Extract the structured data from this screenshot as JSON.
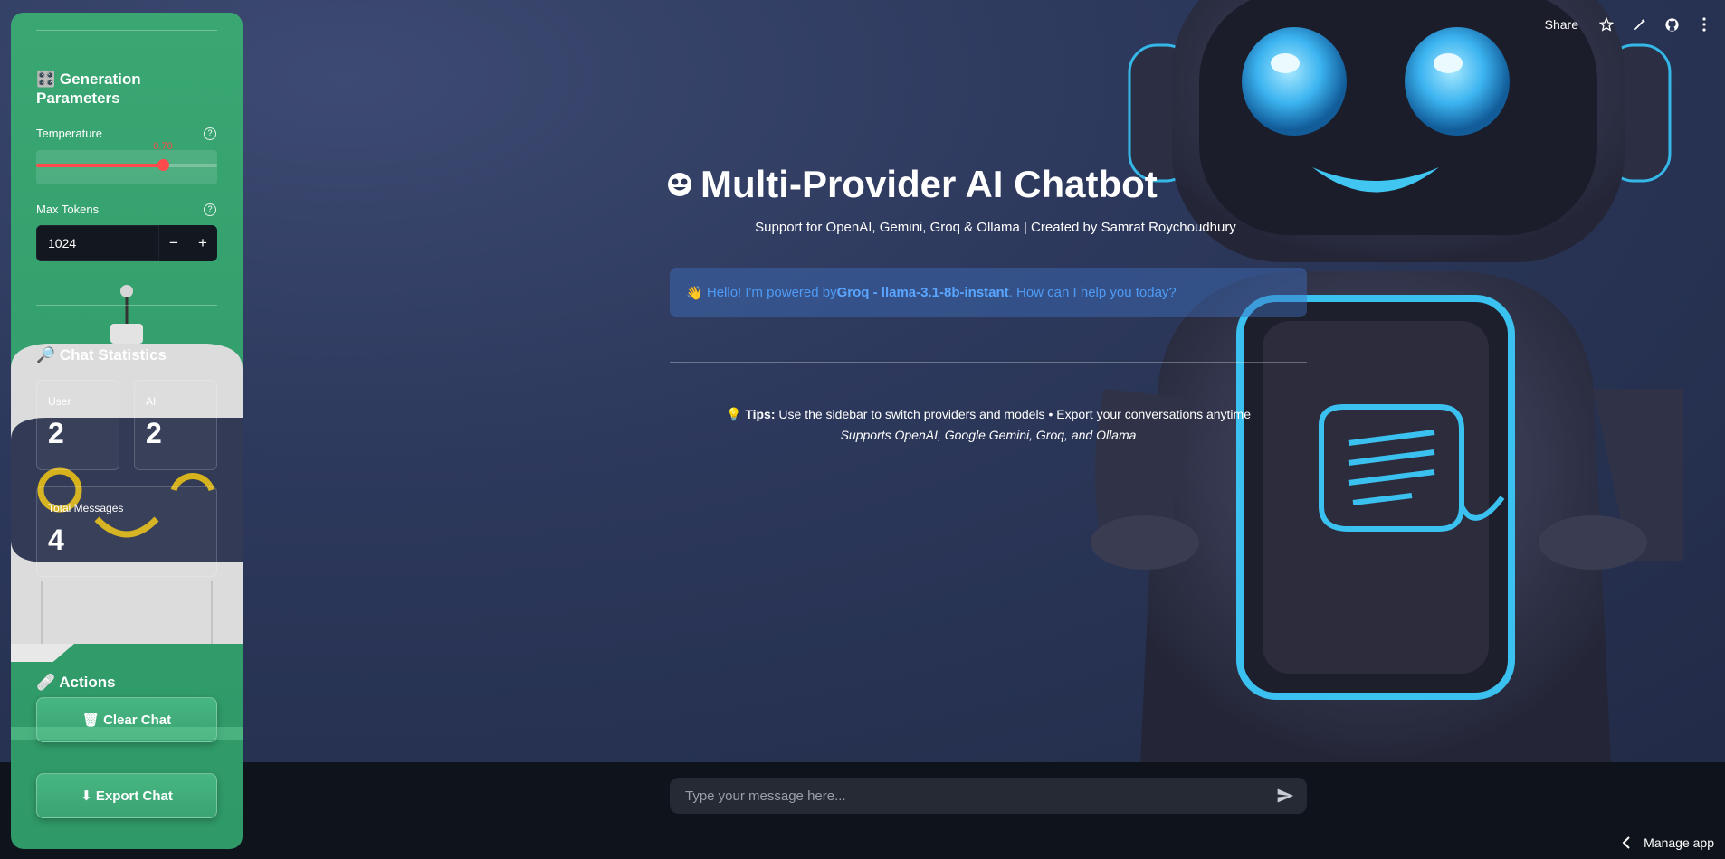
{
  "toolbar": {
    "share_label": "Share"
  },
  "sidebar": {
    "generation_heading": "Generation Parameters",
    "temperature": {
      "label": "Temperature",
      "value": "0.70",
      "fraction": 0.7
    },
    "max_tokens": {
      "label": "Max Tokens",
      "value": "1024",
      "minus": "−",
      "plus": "+"
    },
    "stats_heading": "Chat Statistics",
    "stats": {
      "user_label": "User",
      "user_value": "2",
      "ai_label": "AI",
      "ai_value": "2",
      "total_label": "Total Messages",
      "total_value": "4"
    },
    "actions_heading": "Actions",
    "clear_label": "🗑 Clear Chat",
    "export_label": "⬇ Export Chat"
  },
  "main": {
    "title": "Multi-Provider AI Chatbot",
    "subtitle": "Support for OpenAI, Gemini, Groq & Ollama | Created by Samrat Roychoudhury",
    "assistant_message": {
      "emoji": "👋",
      "prefix": "Hello! I'm powered by ",
      "model": "Groq - llama-3.1-8b-instant",
      "suffix": ". How can I help you today?"
    },
    "tips": {
      "bulb": "💡",
      "label": "Tips:",
      "text": " Use the sidebar to switch providers and models • Export your conversations anytime",
      "supports": "Supports OpenAI, Google Gemini, Groq, and Ollama"
    }
  },
  "chat_input": {
    "placeholder": "Type your message here..."
  },
  "footer": {
    "manage_label": "Manage app"
  },
  "colors": {
    "sidebar": "#34a06d",
    "slider": "#ff4b4b",
    "message_text": "#4f9bf5"
  }
}
